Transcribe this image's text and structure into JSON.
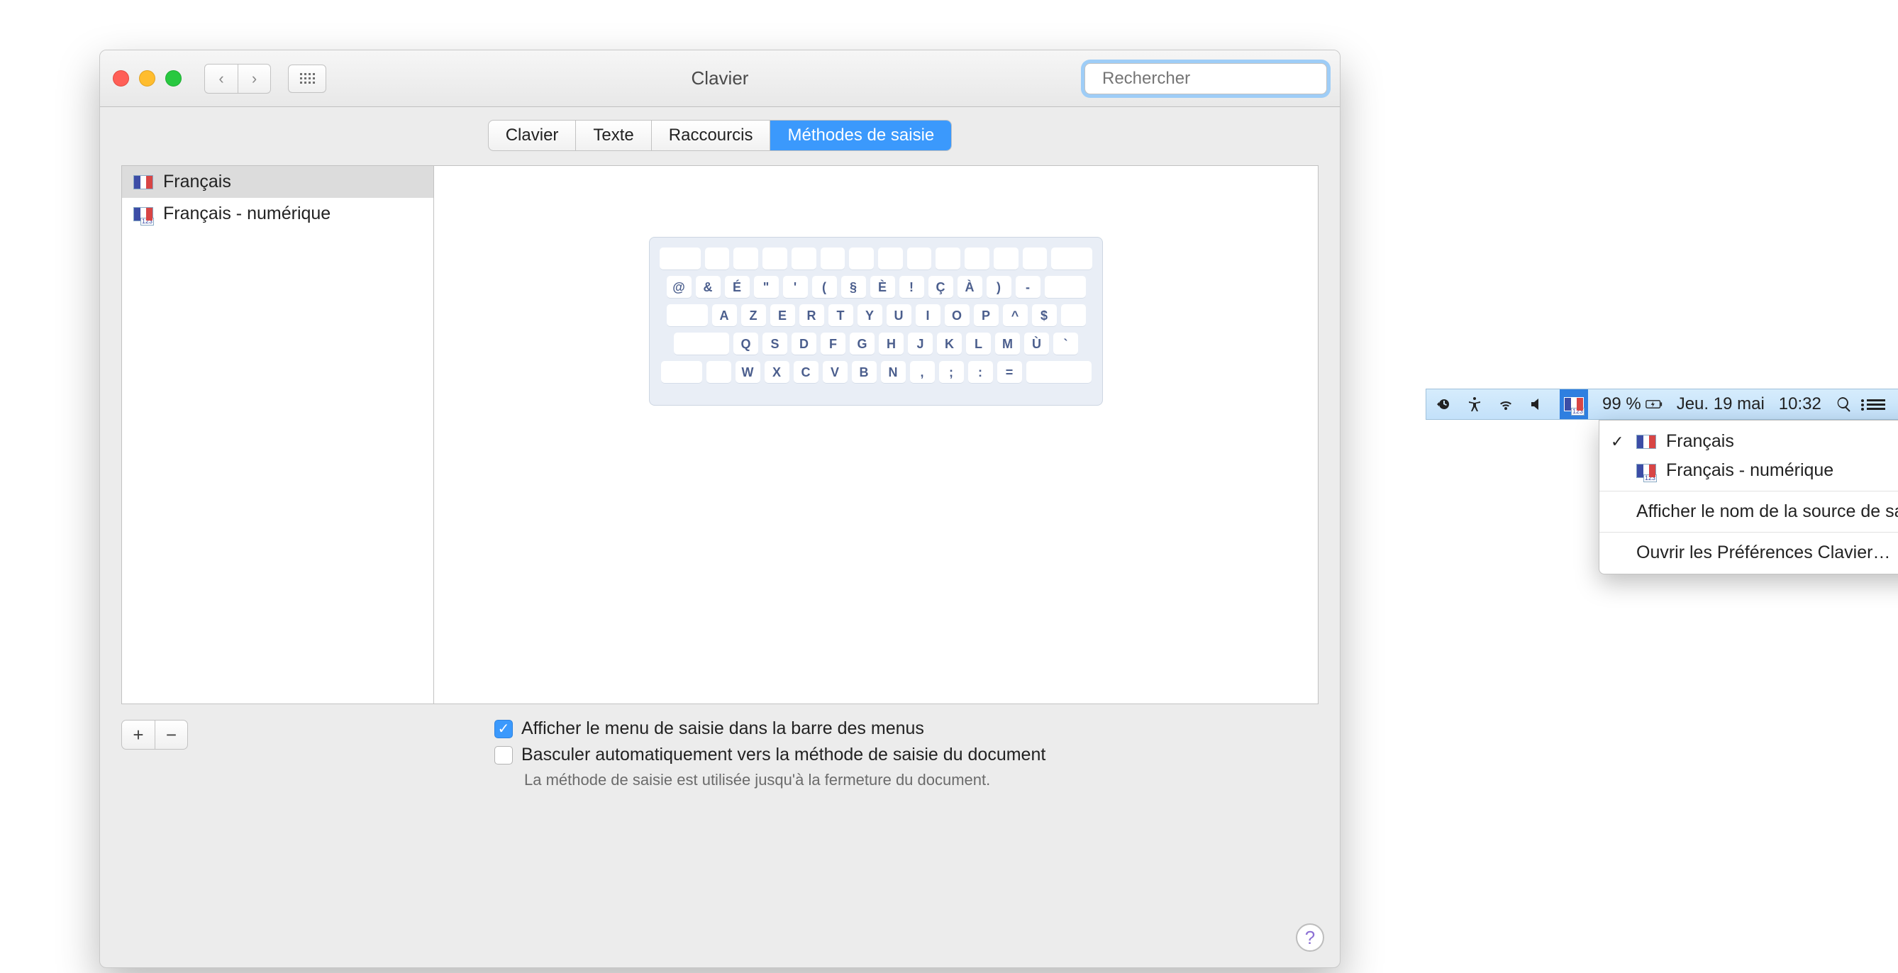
{
  "window": {
    "title": "Clavier",
    "search_placeholder": "Rechercher"
  },
  "tabs": [
    {
      "label": "Clavier"
    },
    {
      "label": "Texte"
    },
    {
      "label": "Raccourcis"
    },
    {
      "label": "Méthodes de saisie"
    }
  ],
  "sources": [
    {
      "label": "Français",
      "numeric": false
    },
    {
      "label": "Français - numérique",
      "numeric": true
    }
  ],
  "keyboard_rows": [
    [
      "@",
      "&",
      "É",
      "\"",
      "'",
      "(",
      "§",
      "È",
      "!",
      "Ç",
      "À",
      ")",
      "-"
    ],
    [
      "A",
      "Z",
      "E",
      "R",
      "T",
      "Y",
      "U",
      "I",
      "O",
      "P",
      "^",
      "$"
    ],
    [
      "Q",
      "S",
      "D",
      "F",
      "G",
      "H",
      "J",
      "K",
      "L",
      "M",
      "Ù",
      "`"
    ],
    [
      "W",
      "X",
      "C",
      "V",
      "B",
      "N",
      ",",
      ";",
      ":",
      "="
    ]
  ],
  "checkbox1": "Afficher le menu de saisie dans la barre des menus",
  "checkbox2": "Basculer automatiquement vers la méthode de saisie du document",
  "hint": "La méthode de saisie est utilisée jusqu'à la fermeture du document.",
  "menubar": {
    "battery_pct": "99 %",
    "date": "Jeu. 19 mai",
    "time": "10:32"
  },
  "dropdown": {
    "item1": "Français",
    "item2": "Français - numérique",
    "item3": "Afficher le nom de la source de saisie",
    "item4": "Ouvrir les Préférences Clavier…"
  }
}
